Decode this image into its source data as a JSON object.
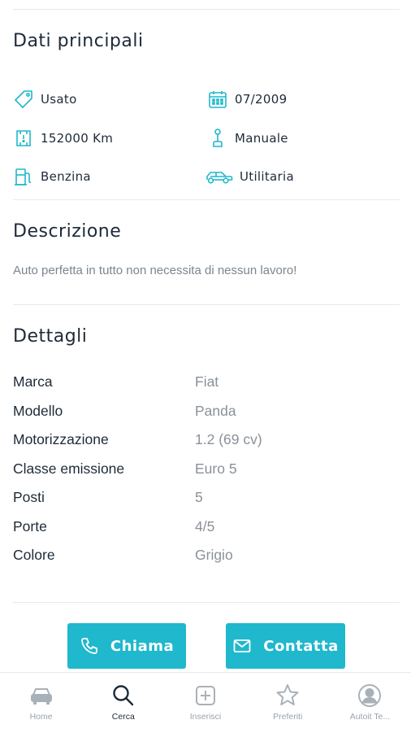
{
  "sections": {
    "main_title": "Dati principali",
    "description_title": "Descrizione",
    "details_title": "Dettagli"
  },
  "specs": [
    {
      "icon": "tag-icon",
      "value": "Usato"
    },
    {
      "icon": "calendar-icon",
      "value": "07/2009"
    },
    {
      "icon": "odometer-icon",
      "value": "152000 Km"
    },
    {
      "icon": "gearshift-icon",
      "value": "Manuale"
    },
    {
      "icon": "fuel-pump-icon",
      "value": "Benzina"
    },
    {
      "icon": "car-body-icon",
      "value": "Utilitaria"
    }
  ],
  "description": "Auto perfetta in tutto non necessita di nessun lavoro!",
  "details": [
    {
      "label": "Marca",
      "value": "Fiat"
    },
    {
      "label": "Modello",
      "value": "Panda"
    },
    {
      "label": "Motorizzazione",
      "value": "1.2 (69 cv)"
    },
    {
      "label": "Classe emissione",
      "value": "Euro 5"
    },
    {
      "label": "Posti",
      "value": "5"
    },
    {
      "label": "Porte",
      "value": "4/5"
    },
    {
      "label": "Colore",
      "value": "Grigio"
    }
  ],
  "actions": {
    "call_label": "Chiama",
    "contact_label": "Contatta"
  },
  "nav": [
    {
      "icon": "car-icon",
      "label": "Home",
      "active": false
    },
    {
      "icon": "search-icon",
      "label": "Cerca",
      "active": true
    },
    {
      "icon": "add-icon",
      "label": "Inserisci",
      "active": false
    },
    {
      "icon": "star-icon",
      "label": "Preferiti",
      "active": false
    },
    {
      "icon": "user-icon",
      "label": "Autoit Te...",
      "active": false
    }
  ],
  "colors": {
    "accent": "#1fb8cc",
    "text": "#1e2a38",
    "muted": "#8a9199"
  }
}
